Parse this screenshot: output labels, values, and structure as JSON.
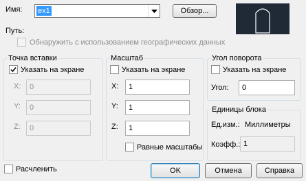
{
  "name_row": {
    "label": "Имя:",
    "value": "ex1",
    "browse_label": "Обзор..."
  },
  "path_label": "Путь:",
  "geo_checkbox": {
    "label": "Обнаружить с использованием географических данных",
    "checked": false,
    "enabled": false
  },
  "insertion_point": {
    "title": "Точка вставки",
    "specify_on_screen": {
      "label": "Указать на экране",
      "checked": true
    },
    "x": {
      "label": "X:",
      "value": "0"
    },
    "y": {
      "label": "Y:",
      "value": "0"
    },
    "z": {
      "label": "Z:",
      "value": "0"
    }
  },
  "scale": {
    "title": "Масштаб",
    "specify_on_screen": {
      "label": "Указать на экране",
      "checked": false
    },
    "x": {
      "label": "X:",
      "value": "1"
    },
    "y": {
      "label": "Y:",
      "value": "1"
    },
    "z": {
      "label": "Z:",
      "value": "1"
    },
    "uniform": {
      "label": "Равные масштабы",
      "checked": false
    }
  },
  "rotation": {
    "title": "Угол поворота",
    "specify_on_screen": {
      "label": "Указать на экране",
      "checked": false
    },
    "angle": {
      "label": "Угол:",
      "value": "0"
    }
  },
  "block_units": {
    "title": "Единицы блока",
    "unit": {
      "label": "Ед.изм.:",
      "value": "Миллиметры"
    },
    "factor": {
      "label": "Коэфф.:",
      "value": "1"
    }
  },
  "explode": {
    "label": "Расчленить",
    "checked": false
  },
  "buttons": {
    "ok": "OK",
    "cancel": "Отмена",
    "help": "Справка"
  },
  "colors": {
    "selection": "#3399ff",
    "preview_bg": "#1f2a36",
    "preview_line": "#ffffff"
  }
}
